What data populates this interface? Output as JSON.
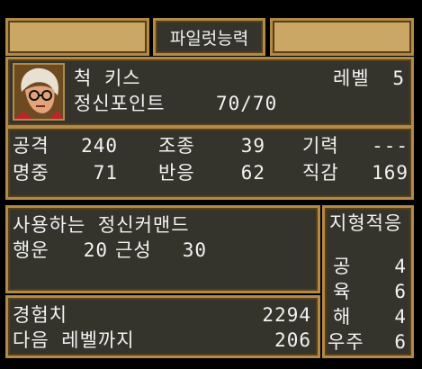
{
  "header": {
    "title": "파일럿능력"
  },
  "pilot": {
    "name": "척 키스",
    "level_label": "레벨",
    "level": "5",
    "sp_label": "정신포인트",
    "sp": "70/70",
    "portrait": "pilot-portrait"
  },
  "stats": {
    "attack_label": "공격",
    "attack": "240",
    "control_label": "조종",
    "control": "39",
    "morale_label": "기력",
    "morale": "---",
    "accuracy_label": "명중",
    "accuracy": "71",
    "reaction_label": "반응",
    "reaction": "62",
    "intuition_label": "직감",
    "intuition": "169"
  },
  "spirit": {
    "heading": "사용하는 정신커맨드",
    "cmd1_label": "행운",
    "cmd1_cost": "20",
    "cmd2_label": "근성",
    "cmd2_cost": "30"
  },
  "terrain": {
    "heading": "지형적응",
    "rows": [
      {
        "label": "공",
        "value": "4"
      },
      {
        "label": "육",
        "value": "6"
      },
      {
        "label": "해",
        "value": "4"
      },
      {
        "label": "우주",
        "value": "6"
      }
    ]
  },
  "exp": {
    "exp_label": "경험치",
    "exp": "2294",
    "next_label": "다음 레벨까지",
    "next": "206"
  },
  "colors": {
    "panel": "#34342c",
    "gold": "#caa765",
    "border": "#b08a48"
  }
}
